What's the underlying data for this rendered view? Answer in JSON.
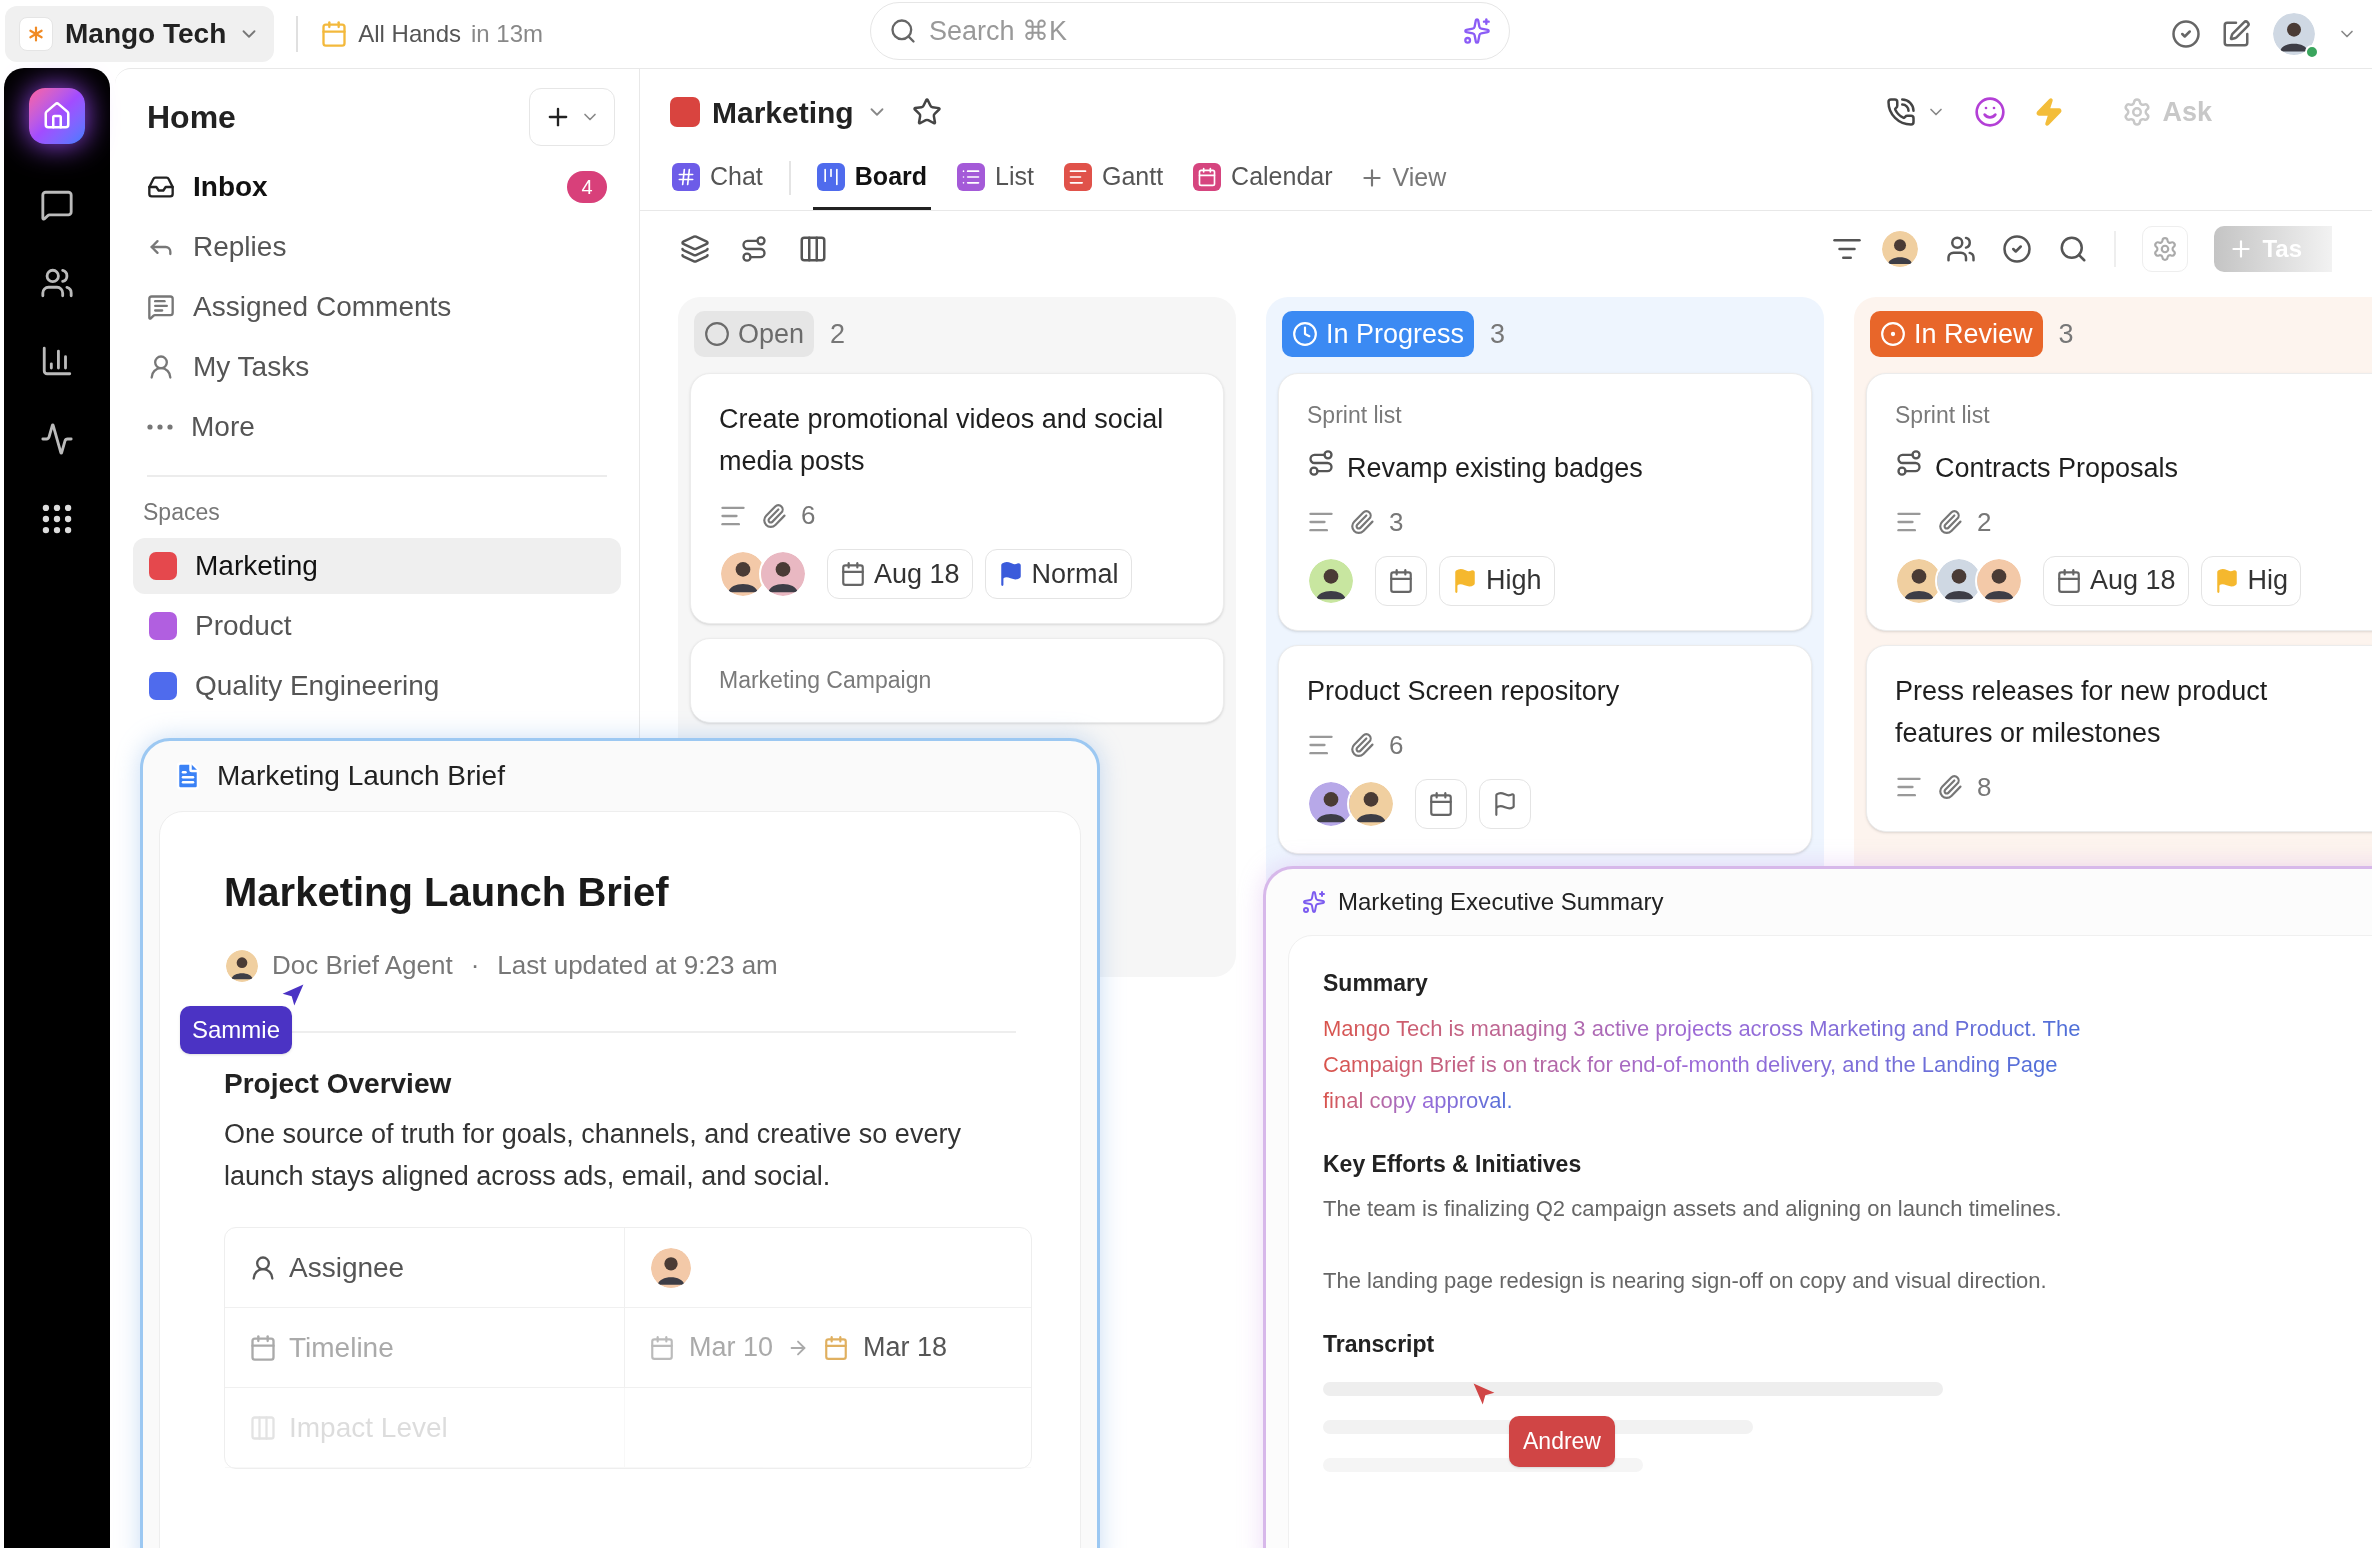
{
  "workspace": {
    "name": "Mango Tech"
  },
  "event": {
    "title": "All Hands",
    "time": "in 13m"
  },
  "search": {
    "placeholder": "Search ⌘K"
  },
  "sidebar": {
    "title": "Home",
    "nav": [
      {
        "label": "Inbox",
        "badge": "4",
        "unread": true
      },
      {
        "label": "Replies",
        "unread": false
      },
      {
        "label": "Assigned Comments",
        "unread": false
      },
      {
        "label": "My Tasks",
        "unread": false
      },
      {
        "label": "More",
        "unread": false
      }
    ],
    "spaces_heading": "Spaces",
    "spaces": [
      {
        "label": "Marketing",
        "color": "#e5484d",
        "selected": true
      },
      {
        "label": "Product",
        "color": "#b15fe0",
        "selected": false
      },
      {
        "label": "Quality Engineering",
        "color": "#4f6bed",
        "selected": false
      }
    ]
  },
  "board": {
    "title": "Marketing",
    "ask": "Ask",
    "new_task": "Tas",
    "add_view": "View",
    "tabs": [
      {
        "label": "Chat",
        "color": "#6d5ce8",
        "selected": false
      },
      {
        "label": "Board",
        "color": "#4f6bed",
        "selected": true
      },
      {
        "label": "List",
        "color": "#a45ad8",
        "selected": false
      },
      {
        "label": "Gantt",
        "color": "#e0524a",
        "selected": false
      },
      {
        "label": "Calendar",
        "color": "#d6457f",
        "selected": false
      }
    ],
    "columns": [
      {
        "status": "Open",
        "count": "2",
        "kind": "open",
        "color": "#6b6b6b",
        "cards": [
          {
            "title": "Create promotional videos and social media posts",
            "attachments": "6",
            "date": {
              "kind": "set",
              "label": "Aug 18"
            },
            "priority": {
              "kind": "set",
              "label": "Normal",
              "color": "#3b5bdb"
            }
          },
          {
            "list": "Marketing Campaign"
          }
        ]
      },
      {
        "status": "In Progress",
        "count": "3",
        "kind": "progress",
        "color": "#3b8af3",
        "cards": [
          {
            "list": "Sprint list",
            "title": "Revamp existing badges",
            "subtask": true,
            "attachments": "3",
            "date": {
              "kind": "empty"
            },
            "priority": {
              "kind": "set",
              "label": "High",
              "color": "#f5b82e"
            }
          },
          {
            "title": "Product Screen repository",
            "subtask": false,
            "attachments": "6",
            "date": {
              "kind": "empty"
            },
            "priority": {
              "kind": "empty"
            }
          }
        ]
      },
      {
        "status": "In Review",
        "count": "3",
        "kind": "review",
        "color": "#e8662a",
        "cards": [
          {
            "list": "Sprint list",
            "title": "Contracts Proposals",
            "subtask": true,
            "attachments": "2",
            "date": {
              "kind": "set",
              "label": "Aug 18"
            },
            "priority": {
              "kind": "set",
              "label": "Hig",
              "color": "#f5b82e"
            }
          },
          {
            "title": "Press releases for new product features or milestones",
            "subtask": false,
            "attachments": "8"
          }
        ]
      }
    ]
  },
  "doc": {
    "header": "Marketing Launch Brief",
    "title": "Marketing Launch Brief",
    "author": "Doc Brief Agent",
    "separator": "·",
    "updated": "Last updated at 9:23 am",
    "cursor": {
      "name": "Sammie",
      "color": "#4b33c4"
    },
    "section": "Project Overview",
    "body": "One source of truth for goals, channels, and creative so every launch stays aligned across ads, email, and social.",
    "fields": [
      {
        "label": "Assignee",
        "kind": "person"
      },
      {
        "label": "Timeline",
        "kind": "dates",
        "start": "Mar 10",
        "end": "Mar 18"
      },
      {
        "label": "Impact Level",
        "kind": "blank"
      }
    ]
  },
  "summary": {
    "title": "Marketing Executive Summary",
    "sections": [
      {
        "heading": "Summary",
        "kind": "gradient",
        "paragraphs": [
          "Mango Tech is managing 3 active projects across Marketing and Product. The",
          "Campaign Brief is on track for end-of-month delivery, and the Landing Page",
          "final copy approval."
        ]
      },
      {
        "heading": "Key Efforts & Initiatives",
        "kind": "plain",
        "paragraphs": [
          "The team is finalizing Q2 campaign assets and aligning on launch timelines.",
          "The landing page redesign is nearing sign-off on copy and visual direction."
        ]
      },
      {
        "heading": "Transcript",
        "kind": "skeleton"
      }
    ],
    "cursor": {
      "name": "Andrew",
      "color": "#d04545"
    }
  }
}
